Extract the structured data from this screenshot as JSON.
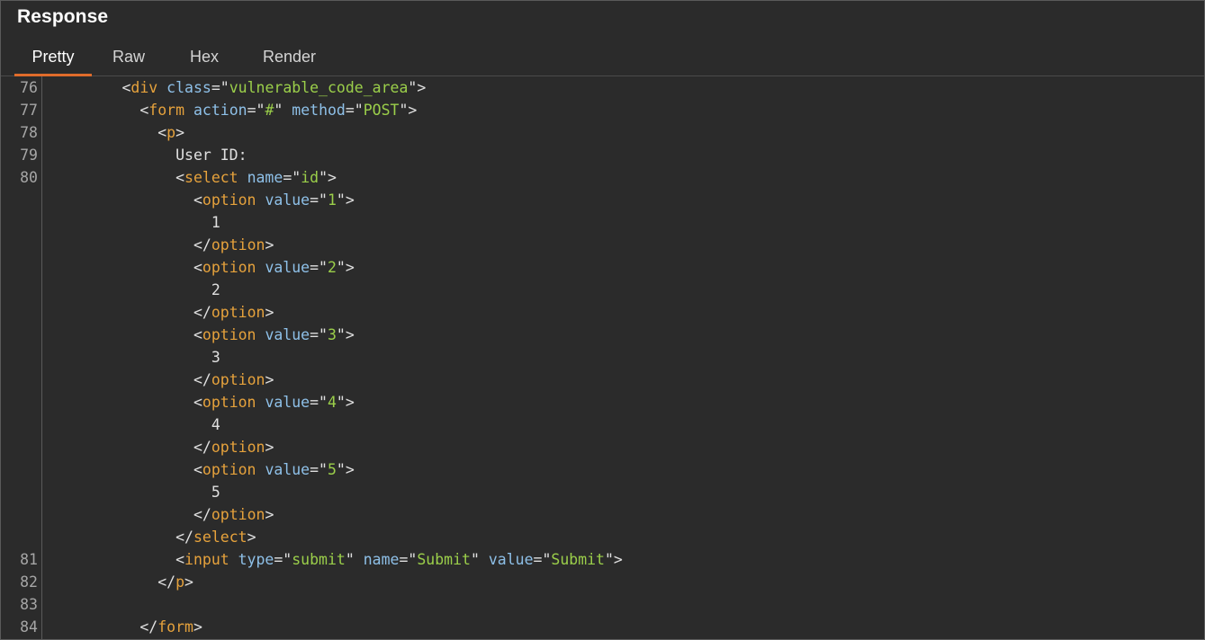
{
  "panel": {
    "title": "Response"
  },
  "tabs": [
    {
      "label": "Pretty",
      "active": true
    },
    {
      "label": "Raw",
      "active": false
    },
    {
      "label": "Hex",
      "active": false
    },
    {
      "label": "Render",
      "active": false
    }
  ],
  "colors": {
    "tag": "#e6a23c",
    "attribute": "#8ec0e8",
    "value": "#9bcf4a",
    "text": "#e0e0e0",
    "active_tab_underline": "#e06c2b",
    "background": "#2b2b2b"
  },
  "code_lines": [
    {
      "ln": "76",
      "indent": 4,
      "tokens": [
        {
          "t": "punc",
          "v": "<"
        },
        {
          "t": "tag",
          "v": "div"
        },
        {
          "t": "punc",
          "v": " "
        },
        {
          "t": "attr",
          "v": "class"
        },
        {
          "t": "punc",
          "v": "=\""
        },
        {
          "t": "val",
          "v": "vulnerable_code_area"
        },
        {
          "t": "punc",
          "v": "\">"
        }
      ]
    },
    {
      "ln": "77",
      "indent": 5,
      "tokens": [
        {
          "t": "punc",
          "v": "<"
        },
        {
          "t": "tag",
          "v": "form"
        },
        {
          "t": "punc",
          "v": " "
        },
        {
          "t": "attr",
          "v": "action"
        },
        {
          "t": "punc",
          "v": "=\""
        },
        {
          "t": "val",
          "v": "#"
        },
        {
          "t": "punc",
          "v": "\" "
        },
        {
          "t": "attr",
          "v": "method"
        },
        {
          "t": "punc",
          "v": "=\""
        },
        {
          "t": "val",
          "v": "POST"
        },
        {
          "t": "punc",
          "v": "\">"
        }
      ]
    },
    {
      "ln": "78",
      "indent": 6,
      "tokens": [
        {
          "t": "punc",
          "v": "<"
        },
        {
          "t": "tag",
          "v": "p"
        },
        {
          "t": "punc",
          "v": ">"
        }
      ]
    },
    {
      "ln": "79",
      "indent": 7,
      "tokens": [
        {
          "t": "txt",
          "v": "User ID:"
        }
      ]
    },
    {
      "ln": "80",
      "indent": 7,
      "tokens": [
        {
          "t": "punc",
          "v": "<"
        },
        {
          "t": "tag",
          "v": "select"
        },
        {
          "t": "punc",
          "v": " "
        },
        {
          "t": "attr",
          "v": "name"
        },
        {
          "t": "punc",
          "v": "=\""
        },
        {
          "t": "val",
          "v": "id"
        },
        {
          "t": "punc",
          "v": "\">"
        }
      ]
    },
    {
      "ln": "",
      "indent": 8,
      "tokens": [
        {
          "t": "punc",
          "v": "<"
        },
        {
          "t": "tag",
          "v": "option"
        },
        {
          "t": "punc",
          "v": " "
        },
        {
          "t": "attr",
          "v": "value"
        },
        {
          "t": "punc",
          "v": "=\""
        },
        {
          "t": "val",
          "v": "1"
        },
        {
          "t": "punc",
          "v": "\">"
        }
      ]
    },
    {
      "ln": "",
      "indent": 9,
      "tokens": [
        {
          "t": "txt",
          "v": "1"
        }
      ]
    },
    {
      "ln": "",
      "indent": 8,
      "tokens": [
        {
          "t": "punc",
          "v": "</"
        },
        {
          "t": "tag",
          "v": "option"
        },
        {
          "t": "punc",
          "v": ">"
        }
      ]
    },
    {
      "ln": "",
      "indent": 8,
      "tokens": [
        {
          "t": "punc",
          "v": "<"
        },
        {
          "t": "tag",
          "v": "option"
        },
        {
          "t": "punc",
          "v": " "
        },
        {
          "t": "attr",
          "v": "value"
        },
        {
          "t": "punc",
          "v": "=\""
        },
        {
          "t": "val",
          "v": "2"
        },
        {
          "t": "punc",
          "v": "\">"
        }
      ]
    },
    {
      "ln": "",
      "indent": 9,
      "tokens": [
        {
          "t": "txt",
          "v": "2"
        }
      ]
    },
    {
      "ln": "",
      "indent": 8,
      "tokens": [
        {
          "t": "punc",
          "v": "</"
        },
        {
          "t": "tag",
          "v": "option"
        },
        {
          "t": "punc",
          "v": ">"
        }
      ]
    },
    {
      "ln": "",
      "indent": 8,
      "tokens": [
        {
          "t": "punc",
          "v": "<"
        },
        {
          "t": "tag",
          "v": "option"
        },
        {
          "t": "punc",
          "v": " "
        },
        {
          "t": "attr",
          "v": "value"
        },
        {
          "t": "punc",
          "v": "=\""
        },
        {
          "t": "val",
          "v": "3"
        },
        {
          "t": "punc",
          "v": "\">"
        }
      ]
    },
    {
      "ln": "",
      "indent": 9,
      "tokens": [
        {
          "t": "txt",
          "v": "3"
        }
      ]
    },
    {
      "ln": "",
      "indent": 8,
      "tokens": [
        {
          "t": "punc",
          "v": "</"
        },
        {
          "t": "tag",
          "v": "option"
        },
        {
          "t": "punc",
          "v": ">"
        }
      ]
    },
    {
      "ln": "",
      "indent": 8,
      "tokens": [
        {
          "t": "punc",
          "v": "<"
        },
        {
          "t": "tag",
          "v": "option"
        },
        {
          "t": "punc",
          "v": " "
        },
        {
          "t": "attr",
          "v": "value"
        },
        {
          "t": "punc",
          "v": "=\""
        },
        {
          "t": "val",
          "v": "4"
        },
        {
          "t": "punc",
          "v": "\">"
        }
      ]
    },
    {
      "ln": "",
      "indent": 9,
      "tokens": [
        {
          "t": "txt",
          "v": "4"
        }
      ]
    },
    {
      "ln": "",
      "indent": 8,
      "tokens": [
        {
          "t": "punc",
          "v": "</"
        },
        {
          "t": "tag",
          "v": "option"
        },
        {
          "t": "punc",
          "v": ">"
        }
      ]
    },
    {
      "ln": "",
      "indent": 8,
      "tokens": [
        {
          "t": "punc",
          "v": "<"
        },
        {
          "t": "tag",
          "v": "option"
        },
        {
          "t": "punc",
          "v": " "
        },
        {
          "t": "attr",
          "v": "value"
        },
        {
          "t": "punc",
          "v": "=\""
        },
        {
          "t": "val",
          "v": "5"
        },
        {
          "t": "punc",
          "v": "\">"
        }
      ]
    },
    {
      "ln": "",
      "indent": 9,
      "tokens": [
        {
          "t": "txt",
          "v": "5"
        }
      ]
    },
    {
      "ln": "",
      "indent": 8,
      "tokens": [
        {
          "t": "punc",
          "v": "</"
        },
        {
          "t": "tag",
          "v": "option"
        },
        {
          "t": "punc",
          "v": ">"
        }
      ]
    },
    {
      "ln": "",
      "indent": 7,
      "tokens": [
        {
          "t": "punc",
          "v": "</"
        },
        {
          "t": "tag",
          "v": "select"
        },
        {
          "t": "punc",
          "v": ">"
        }
      ]
    },
    {
      "ln": "81",
      "indent": 7,
      "tokens": [
        {
          "t": "punc",
          "v": "<"
        },
        {
          "t": "tag",
          "v": "input"
        },
        {
          "t": "punc",
          "v": " "
        },
        {
          "t": "attr",
          "v": "type"
        },
        {
          "t": "punc",
          "v": "=\""
        },
        {
          "t": "val",
          "v": "submit"
        },
        {
          "t": "punc",
          "v": "\" "
        },
        {
          "t": "attr",
          "v": "name"
        },
        {
          "t": "punc",
          "v": "=\""
        },
        {
          "t": "val",
          "v": "Submit"
        },
        {
          "t": "punc",
          "v": "\" "
        },
        {
          "t": "attr",
          "v": "value"
        },
        {
          "t": "punc",
          "v": "=\""
        },
        {
          "t": "val",
          "v": "Submit"
        },
        {
          "t": "punc",
          "v": "\">"
        }
      ]
    },
    {
      "ln": "82",
      "indent": 6,
      "tokens": [
        {
          "t": "punc",
          "v": "</"
        },
        {
          "t": "tag",
          "v": "p"
        },
        {
          "t": "punc",
          "v": ">"
        }
      ]
    },
    {
      "ln": "83",
      "indent": 0,
      "tokens": []
    },
    {
      "ln": "84",
      "indent": 5,
      "tokens": [
        {
          "t": "punc",
          "v": "</"
        },
        {
          "t": "tag",
          "v": "form"
        },
        {
          "t": "punc",
          "v": ">"
        }
      ]
    }
  ]
}
